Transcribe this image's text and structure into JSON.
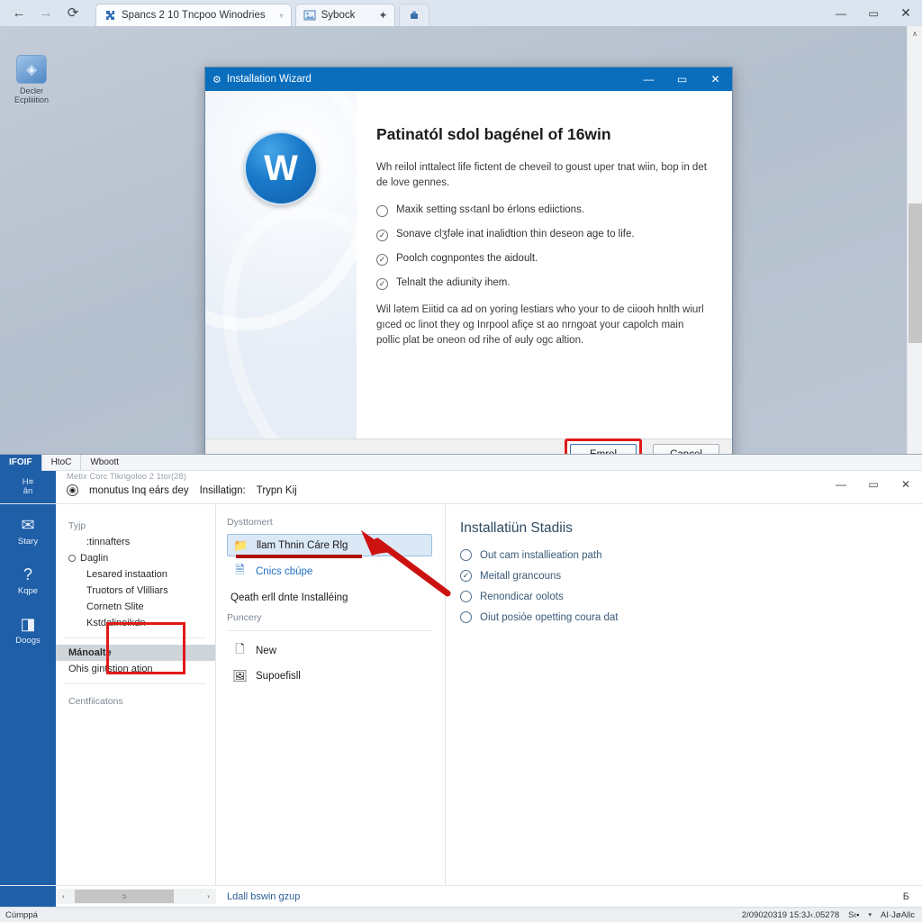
{
  "browser": {
    "nav": {
      "back": "←",
      "forward": "→",
      "reload": "⟳"
    },
    "tabs": [
      {
        "title": "Spancs 2 10 Tncpoo Winodries",
        "favicon": "puzzle-icon",
        "caret": "▿",
        "active": true
      },
      {
        "title": "Sybock",
        "favicon": "image-icon",
        "pin": "✦",
        "active": false
      }
    ],
    "extension_icon": "extension-icon",
    "window_controls": {
      "minimize": "—",
      "maximize": "▭",
      "close": "✕"
    },
    "scrollbar": {
      "up": "∧",
      "down": "∨"
    }
  },
  "desktop": {
    "icon": {
      "glyph": "◈",
      "label_line1": "Decler",
      "label_line2": "Ecpliiition"
    }
  },
  "wizard": {
    "title": "Installation Wizard",
    "title_icon": "wizard-icon",
    "logo_text": "W",
    "heading": "Patinatól sdol bagénel of 16win",
    "intro": "Wh reilol inttalect life fictent de cheveil to goust uper tnat wiin, bop in det de love gennes.",
    "items": [
      {
        "checked": false,
        "text": "Maxik setting ss‹tanl bo érlons ediictions."
      },
      {
        "checked": true,
        "text": "Sonave clʒfəle inat inalidtion thin deseon age to life."
      },
      {
        "checked": true,
        "text": "Poolch cognpontes the aidoult."
      },
      {
        "checked": true,
        "text": "Telnalt the adiunity ihem."
      }
    ],
    "outro": "Wil lətem Eiitid ca ad on yoring lestiars who your to de ciiooh hnlth wiurl ɡıced oc linot they og Inrpool afiçe st ao nrngoat your capolch main pollic plat be oneon od rihe of əuly ogc altion.",
    "buttons": {
      "primary": "Emrel",
      "secondary": "Cancel"
    },
    "window_controls": {
      "minimize": "—",
      "maximize": "▭",
      "close": "✕"
    }
  },
  "manager": {
    "tabs": [
      {
        "label": "IFOIF",
        "accent": true
      },
      {
        "label": "HtoC"
      },
      {
        "label": "Wboott"
      }
    ],
    "rail_header": {
      "line1": "H≡",
      "line2": "ân"
    },
    "path": "Metix Corc Tlkrigoloo 2 1tor(28)",
    "command_icon": "globe-icon",
    "commands": [
      "monutus Inq eárs dey",
      "Insillatign:",
      "Trypn Kij"
    ],
    "window_controls": {
      "minimize": "—",
      "maximize": "▭",
      "close": "✕"
    },
    "rail": [
      {
        "glyph": "✉",
        "label": "Stary",
        "icon": "mail-icon"
      },
      {
        "glyph": "?",
        "label": "Kqpe",
        "icon": "help-icon"
      },
      {
        "glyph": "◨",
        "label": "Doogs",
        "icon": "docs-icon"
      }
    ],
    "nav": {
      "group_top": "Tyjp",
      "links": [
        {
          "text": ":tinnafters",
          "indent": "sub"
        },
        {
          "text": "Daglin",
          "indent": "root",
          "dot": true
        },
        {
          "text": "Lesared instaation",
          "indent": "sub"
        },
        {
          "text": "Truotors of Vlilliars",
          "indent": "sub"
        },
        {
          "text": "Cornetn Slite",
          "indent": "sub"
        },
        {
          "text": "Kstdalineikdn",
          "indent": "sub"
        }
      ],
      "selected": "Mánoalte",
      "after_selected": "Ohis gintstion ation",
      "group_bottom": "Centfiicatons"
    },
    "middle": {
      "group_top": "Dysttomert",
      "selected_row": {
        "icon": "folder-icon",
        "text": "llam Thnin Cáre Rlg"
      },
      "link_row": {
        "icon": "file-icon",
        "text": "Cnics cbúpe"
      },
      "note": "Qeath erll dnte Installéing",
      "group_bottom": "Puncery",
      "rows": [
        {
          "icon": "new-doc-icon",
          "text": "New"
        },
        {
          "icon": "picture-icon",
          "text": "Supoefisll"
        }
      ]
    },
    "status": {
      "title": "Installatiün Stadiis",
      "items": [
        {
          "checked": false,
          "text": "Out cam installieation path"
        },
        {
          "checked": true,
          "text": "Meitall grancouns"
        },
        {
          "checked": false,
          "text": "Renondicar oolots"
        },
        {
          "checked": false,
          "text": "Oiut posiòe opetting coura dat"
        }
      ]
    },
    "footer": {
      "hscroll": {
        "left": "‹",
        "right": "›",
        "thumb_label": "ɔ"
      },
      "message": "Ldall bswin gzup",
      "right_icon": "Б"
    }
  },
  "taskbar": {
    "left": "Cúmpрá",
    "timestamp": "2/09020319  15:3J‹.05278",
    "lang": "Sı▪",
    "lang_caret": "▾",
    "right": "AI·JøAllc"
  }
}
